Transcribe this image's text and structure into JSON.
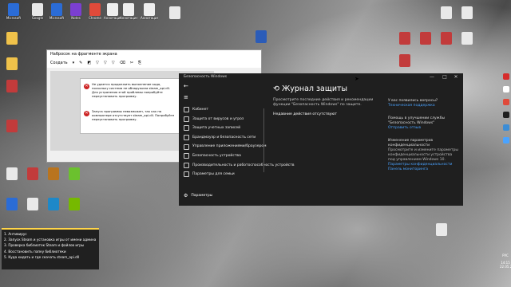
{
  "desktop_icons_top": [
    {
      "label": "Microsoft",
      "color": "#2b6cd6"
    },
    {
      "label": "Google",
      "color": "#e9e9e9"
    },
    {
      "label": "Microsoft",
      "color": "#2b6cd6"
    },
    {
      "label": "Notes",
      "color": "#7b3fd1"
    },
    {
      "label": "Chrome",
      "color": "#e04a3a"
    },
    {
      "label": "Аннотация 2020-05...",
      "color": "#eeeeee"
    },
    {
      "label": "Аннотация 2020-05...",
      "color": "#eeeeee"
    },
    {
      "label": "Аннотация 2020-05...",
      "color": "#eeeeee"
    }
  ],
  "snip_window": {
    "title": "Набросок на фрагменте экрана",
    "toolbar": [
      "Создать",
      "▾",
      "✎",
      "◩",
      "▽",
      "▽",
      "▽",
      "⌫",
      "✂",
      "⎘"
    ],
    "dialog_error_1": "Не удается продолжить выполнение кода, поскольку система не обнаружила steam_api.dll. Для устранения этой проблемы попробуйте переустановить программу.",
    "dialog_error_2": "Запуск программы невозможен, так как на компьютере отсутствует steam_api.dll. Попробуйте переустановить программу."
  },
  "security_window": {
    "title": "Безопасность Windows",
    "controls": [
      "—",
      "□",
      "✕"
    ],
    "back": "←",
    "menu": "≡",
    "nav_items": [
      "Кабинет",
      "Защита от вирусов и угроз",
      "Защита учетных записей",
      "Брандмауэр и безопасность сети",
      "Управление приложениями/браузером",
      "Безопасность устройства",
      "Производительность и работоспособность устройств",
      "Параметры для семьи"
    ],
    "settings_label": "Параметры",
    "page_title": "Журнал защиты",
    "description": "Просмотрите последние действия и рекомендации функции \"Безопасность Windows\" по защите.",
    "status": "Недавние действия отсутствуют",
    "right_panel": {
      "q_title": "У вас появились вопросы?",
      "q_link": "Техническая поддержка",
      "improve_title": "Помощь в улучшении службы \"Безопасность Windows\"",
      "improve_link": "Отправить отзыв",
      "privacy_title": "Изменение параметров конфиденциальности",
      "privacy_desc": "Просмотрите и измените параметры конфиденциальности устройства под управлением Windows 10.",
      "privacy_link1": "Параметры конфиденциальности",
      "privacy_link2": "Панель мониторинга"
    }
  },
  "sticky_note": {
    "lines": [
      "1. Антивирус",
      "2. Запуск Steam и установка игры от имени админа",
      "3. Проверка библиотек Steam и файлов игры",
      "4. Восстановить папку библиотеки",
      "5. Куда кидать и где скачать steam_api.dll"
    ]
  },
  "tray": {
    "lang": "РУС",
    "time": "14:15",
    "date": "22.05.2020"
  },
  "colors": {
    "accent_link": "#4aa3ff",
    "note_border": "#ffd54a",
    "error_red": "#c22222"
  }
}
